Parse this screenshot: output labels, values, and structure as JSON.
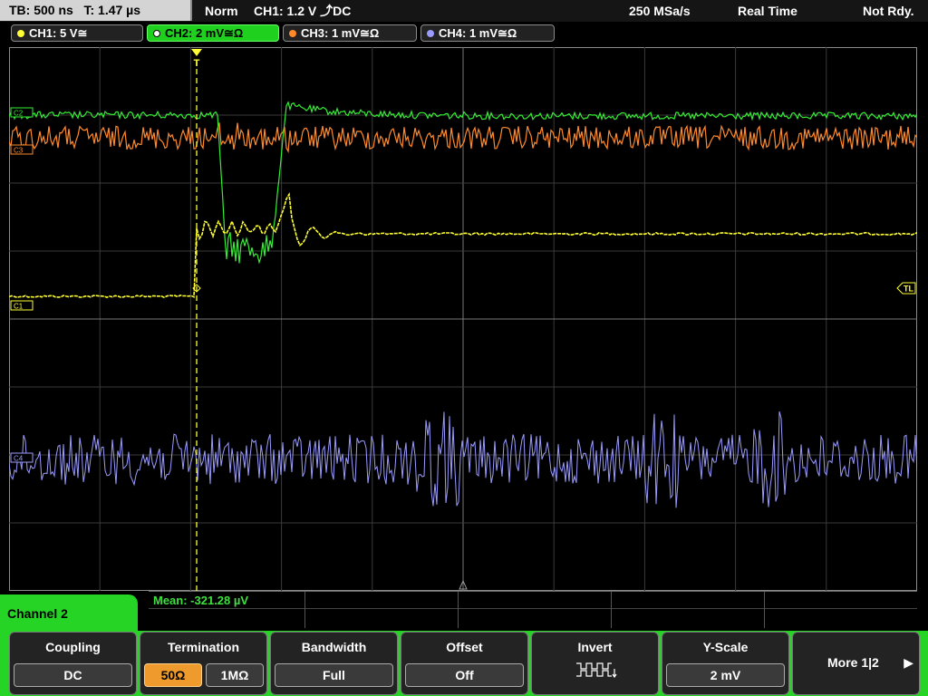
{
  "status_bar": {
    "timebase": "TB: 500 ns",
    "trigger_time": "T: 1.47 µs",
    "trigger_mode": "Norm",
    "trigger_source": "CH1: 1.2 V ⤴DC",
    "sample_rate": "250 MSa/s",
    "acq_mode": "Real Time",
    "status": "Not Rdy."
  },
  "channel_tabs": [
    {
      "label": "CH1: 5 V≅",
      "color": "#ffff33",
      "active": false
    },
    {
      "label": "CH2: 2 mV≅Ω",
      "color": "#33ff33",
      "active": true
    },
    {
      "label": "CH3: 1 mV≅Ω",
      "color": "#ff8a2a",
      "active": false
    },
    {
      "label": "CH4: 1 mV≅Ω",
      "color": "#9a9aff",
      "active": false
    }
  ],
  "markers": {
    "ch1": "C1",
    "ch2": "C2",
    "ch3": "C3",
    "ch4": "C4",
    "trigger_level": "TL",
    "trigger_pos": "T"
  },
  "colors": {
    "ch1": "#ffff33",
    "ch2": "#33ee33",
    "ch3": "#ff8a2a",
    "ch4": "#9b9bff"
  },
  "measurement": {
    "text": "Mean: -321.28 µV"
  },
  "softkey_menu": {
    "title": "Channel 2",
    "coupling": {
      "label": "Coupling",
      "value": "DC"
    },
    "termination": {
      "label": "Termination",
      "options": [
        "50Ω",
        "1MΩ"
      ],
      "selected": 0
    },
    "bandwidth": {
      "label": "Bandwidth",
      "value": "Full"
    },
    "offset": {
      "label": "Offset",
      "value": "Off"
    },
    "invert": {
      "label": "Invert",
      "icon": "invert-waveform-icon"
    },
    "yscale": {
      "label": "Y-Scale",
      "value": "2 mV"
    },
    "more": {
      "label": "More 1|2",
      "icon": "arrow-right-icon"
    }
  }
}
